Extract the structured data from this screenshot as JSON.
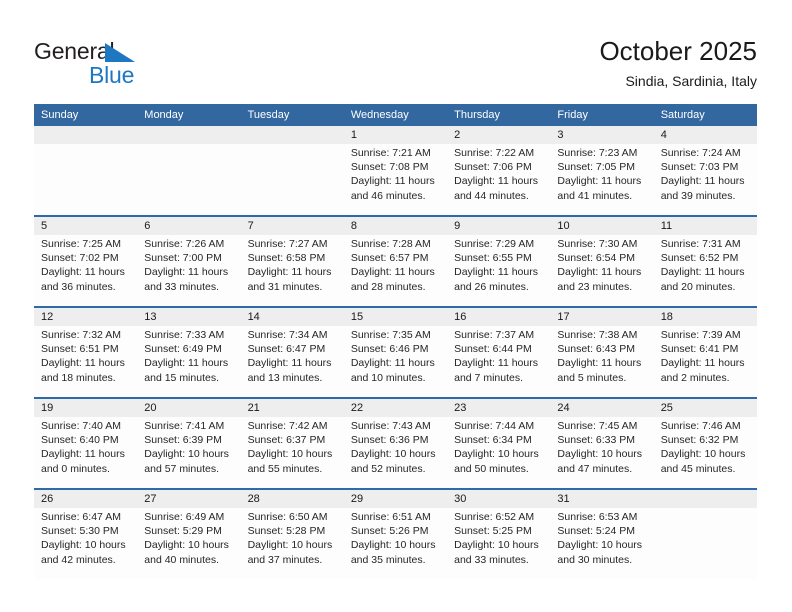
{
  "brand": {
    "name_part1": "General",
    "name_part2": "Blue",
    "triangle_color": "#1d78c1"
  },
  "header": {
    "title": "October 2025",
    "subtitle": "Sindia, Sardinia, Italy",
    "header_bg": "#32679f",
    "separator_color": "#2c6ba8",
    "daterow_bg": "#eeeeee"
  },
  "weekdays": [
    "Sunday",
    "Monday",
    "Tuesday",
    "Wednesday",
    "Thursday",
    "Friday",
    "Saturday"
  ],
  "weeks": [
    {
      "cells": [
        {
          "day": "",
          "lines": []
        },
        {
          "day": "",
          "lines": []
        },
        {
          "day": "",
          "lines": []
        },
        {
          "day": "1",
          "lines": [
            "Sunrise: 7:21 AM",
            "Sunset: 7:08 PM",
            "Daylight: 11 hours",
            "and 46 minutes."
          ]
        },
        {
          "day": "2",
          "lines": [
            "Sunrise: 7:22 AM",
            "Sunset: 7:06 PM",
            "Daylight: 11 hours",
            "and 44 minutes."
          ]
        },
        {
          "day": "3",
          "lines": [
            "Sunrise: 7:23 AM",
            "Sunset: 7:05 PM",
            "Daylight: 11 hours",
            "and 41 minutes."
          ]
        },
        {
          "day": "4",
          "lines": [
            "Sunrise: 7:24 AM",
            "Sunset: 7:03 PM",
            "Daylight: 11 hours",
            "and 39 minutes."
          ]
        }
      ]
    },
    {
      "cells": [
        {
          "day": "5",
          "lines": [
            "Sunrise: 7:25 AM",
            "Sunset: 7:02 PM",
            "Daylight: 11 hours",
            "and 36 minutes."
          ]
        },
        {
          "day": "6",
          "lines": [
            "Sunrise: 7:26 AM",
            "Sunset: 7:00 PM",
            "Daylight: 11 hours",
            "and 33 minutes."
          ]
        },
        {
          "day": "7",
          "lines": [
            "Sunrise: 7:27 AM",
            "Sunset: 6:58 PM",
            "Daylight: 11 hours",
            "and 31 minutes."
          ]
        },
        {
          "day": "8",
          "lines": [
            "Sunrise: 7:28 AM",
            "Sunset: 6:57 PM",
            "Daylight: 11 hours",
            "and 28 minutes."
          ]
        },
        {
          "day": "9",
          "lines": [
            "Sunrise: 7:29 AM",
            "Sunset: 6:55 PM",
            "Daylight: 11 hours",
            "and 26 minutes."
          ]
        },
        {
          "day": "10",
          "lines": [
            "Sunrise: 7:30 AM",
            "Sunset: 6:54 PM",
            "Daylight: 11 hours",
            "and 23 minutes."
          ]
        },
        {
          "day": "11",
          "lines": [
            "Sunrise: 7:31 AM",
            "Sunset: 6:52 PM",
            "Daylight: 11 hours",
            "and 20 minutes."
          ]
        }
      ]
    },
    {
      "cells": [
        {
          "day": "12",
          "lines": [
            "Sunrise: 7:32 AM",
            "Sunset: 6:51 PM",
            "Daylight: 11 hours",
            "and 18 minutes."
          ]
        },
        {
          "day": "13",
          "lines": [
            "Sunrise: 7:33 AM",
            "Sunset: 6:49 PM",
            "Daylight: 11 hours",
            "and 15 minutes."
          ]
        },
        {
          "day": "14",
          "lines": [
            "Sunrise: 7:34 AM",
            "Sunset: 6:47 PM",
            "Daylight: 11 hours",
            "and 13 minutes."
          ]
        },
        {
          "day": "15",
          "lines": [
            "Sunrise: 7:35 AM",
            "Sunset: 6:46 PM",
            "Daylight: 11 hours",
            "and 10 minutes."
          ]
        },
        {
          "day": "16",
          "lines": [
            "Sunrise: 7:37 AM",
            "Sunset: 6:44 PM",
            "Daylight: 11 hours",
            "and 7 minutes."
          ]
        },
        {
          "day": "17",
          "lines": [
            "Sunrise: 7:38 AM",
            "Sunset: 6:43 PM",
            "Daylight: 11 hours",
            "and 5 minutes."
          ]
        },
        {
          "day": "18",
          "lines": [
            "Sunrise: 7:39 AM",
            "Sunset: 6:41 PM",
            "Daylight: 11 hours",
            "and 2 minutes."
          ]
        }
      ]
    },
    {
      "cells": [
        {
          "day": "19",
          "lines": [
            "Sunrise: 7:40 AM",
            "Sunset: 6:40 PM",
            "Daylight: 11 hours",
            "and 0 minutes."
          ]
        },
        {
          "day": "20",
          "lines": [
            "Sunrise: 7:41 AM",
            "Sunset: 6:39 PM",
            "Daylight: 10 hours",
            "and 57 minutes."
          ]
        },
        {
          "day": "21",
          "lines": [
            "Sunrise: 7:42 AM",
            "Sunset: 6:37 PM",
            "Daylight: 10 hours",
            "and 55 minutes."
          ]
        },
        {
          "day": "22",
          "lines": [
            "Sunrise: 7:43 AM",
            "Sunset: 6:36 PM",
            "Daylight: 10 hours",
            "and 52 minutes."
          ]
        },
        {
          "day": "23",
          "lines": [
            "Sunrise: 7:44 AM",
            "Sunset: 6:34 PM",
            "Daylight: 10 hours",
            "and 50 minutes."
          ]
        },
        {
          "day": "24",
          "lines": [
            "Sunrise: 7:45 AM",
            "Sunset: 6:33 PM",
            "Daylight: 10 hours",
            "and 47 minutes."
          ]
        },
        {
          "day": "25",
          "lines": [
            "Sunrise: 7:46 AM",
            "Sunset: 6:32 PM",
            "Daylight: 10 hours",
            "and 45 minutes."
          ]
        }
      ]
    },
    {
      "cells": [
        {
          "day": "26",
          "lines": [
            "Sunrise: 6:47 AM",
            "Sunset: 5:30 PM",
            "Daylight: 10 hours",
            "and 42 minutes."
          ]
        },
        {
          "day": "27",
          "lines": [
            "Sunrise: 6:49 AM",
            "Sunset: 5:29 PM",
            "Daylight: 10 hours",
            "and 40 minutes."
          ]
        },
        {
          "day": "28",
          "lines": [
            "Sunrise: 6:50 AM",
            "Sunset: 5:28 PM",
            "Daylight: 10 hours",
            "and 37 minutes."
          ]
        },
        {
          "day": "29",
          "lines": [
            "Sunrise: 6:51 AM",
            "Sunset: 5:26 PM",
            "Daylight: 10 hours",
            "and 35 minutes."
          ]
        },
        {
          "day": "30",
          "lines": [
            "Sunrise: 6:52 AM",
            "Sunset: 5:25 PM",
            "Daylight: 10 hours",
            "and 33 minutes."
          ]
        },
        {
          "day": "31",
          "lines": [
            "Sunrise: 6:53 AM",
            "Sunset: 5:24 PM",
            "Daylight: 10 hours",
            "and 30 minutes."
          ]
        },
        {
          "day": "",
          "lines": []
        }
      ]
    }
  ]
}
